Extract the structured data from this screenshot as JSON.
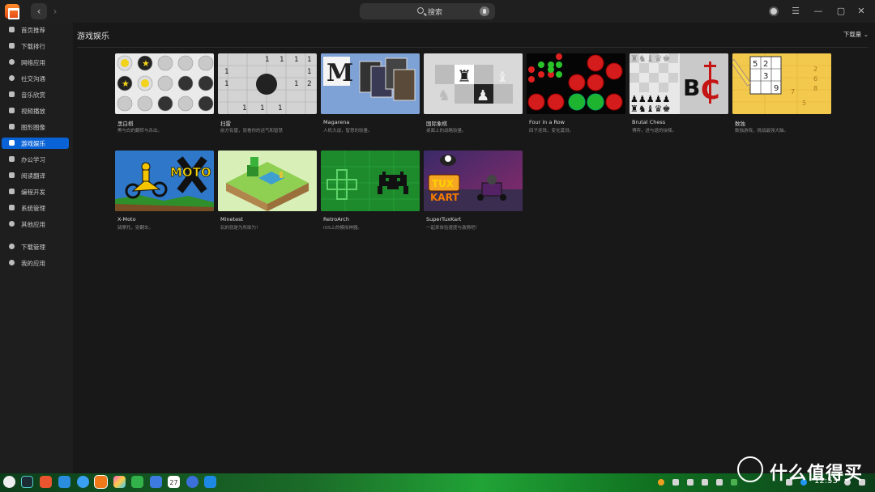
{
  "window": {
    "search_placeholder": "搜索",
    "nav_back": "‹",
    "nav_forward": "›"
  },
  "sidebar": {
    "items": [
      {
        "label": "首页推荐",
        "icon": "star-icon"
      },
      {
        "label": "下载排行",
        "icon": "crown-icon"
      },
      {
        "label": "网络应用",
        "icon": "globe-icon"
      },
      {
        "label": "社交沟通",
        "icon": "chat-icon"
      },
      {
        "label": "音乐欣赏",
        "icon": "music-icon"
      },
      {
        "label": "视频播放",
        "icon": "video-icon"
      },
      {
        "label": "图形图像",
        "icon": "image-icon"
      },
      {
        "label": "游戏娱乐",
        "icon": "gamepad-icon",
        "active": true
      },
      {
        "label": "办公学习",
        "icon": "book-icon"
      },
      {
        "label": "阅读翻译",
        "icon": "reader-icon"
      },
      {
        "label": "编程开发",
        "icon": "code-icon"
      },
      {
        "label": "系统管理",
        "icon": "system-icon"
      },
      {
        "label": "其他应用",
        "icon": "more-icon"
      },
      {
        "label": "下载管理",
        "icon": "download-icon"
      },
      {
        "label": "我的应用",
        "icon": "my-apps-icon"
      }
    ]
  },
  "main": {
    "title": "游戏娱乐",
    "sort_label": "下载量",
    "apps": [
      {
        "name": "黑白棋",
        "desc": "黑与白的翻转与杀出。"
      },
      {
        "name": "扫雷",
        "desc": "前方有雷，就看你的运气和智慧"
      },
      {
        "name": "Magarena",
        "desc": "人机大战，智慧的较量。"
      },
      {
        "name": "国际象棋",
        "desc": "桌面上的战略较量。"
      },
      {
        "name": "Four in a Row",
        "desc": "四子连珠，变化莫测。"
      },
      {
        "name": "Brutal Chess",
        "desc": "博弈，进与退的抉择。"
      },
      {
        "name": "数独",
        "desc": "数独游戏，挑战最强大脑。"
      },
      {
        "name": "X-Moto",
        "desc": "骑摩托，别翻车。"
      },
      {
        "name": "Minetest",
        "desc": "玩的就是为所欲为！"
      },
      {
        "name": "RetroArch",
        "desc": "iOS上的模拟神器。"
      },
      {
        "name": "SuperTuxKart",
        "desc": "一起来体验速度与激情吧！"
      }
    ]
  },
  "taskbar": {
    "clock": "12:53",
    "dock": [
      "launcher-icon",
      "terminal-icon",
      "app-grid-icon",
      "files-icon",
      "browser-icon",
      "app-store-icon",
      "image-viewer-icon",
      "music-player-icon",
      "document-icon",
      "calendar-icon",
      "settings-icon",
      "control-center-icon"
    ],
    "calendar_day": "27"
  },
  "watermark": {
    "text": "什么值得买"
  }
}
